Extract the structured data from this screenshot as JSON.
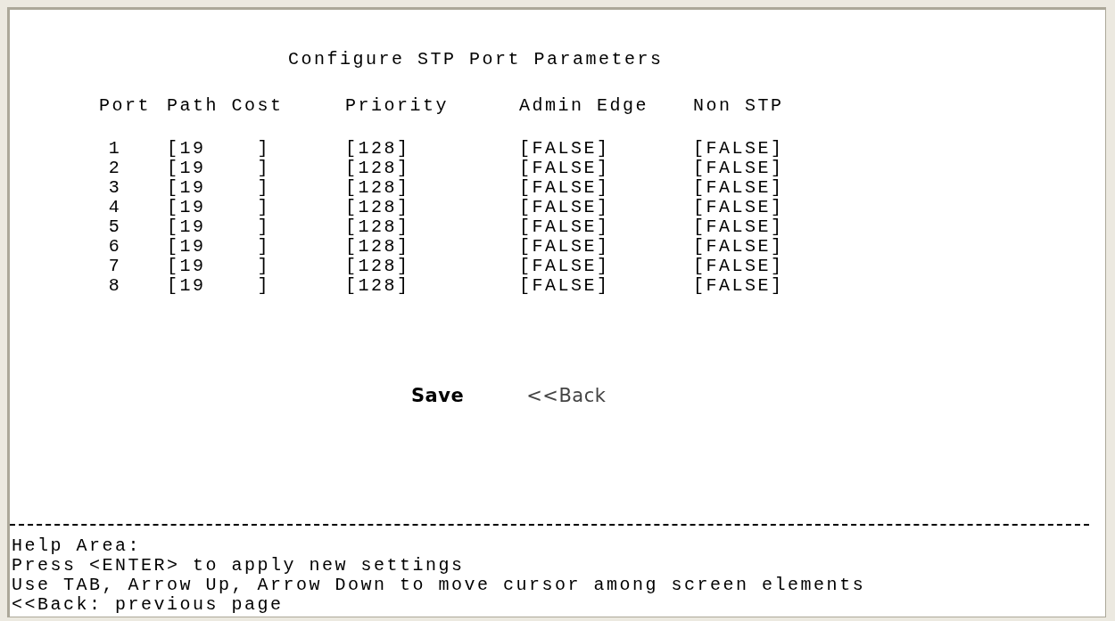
{
  "title": "Configure STP Port Parameters",
  "columns": [
    "Port",
    "Path Cost",
    "Priority",
    "Admin Edge",
    "Non STP"
  ],
  "rows": [
    {
      "port": "1",
      "path_cost": "[19    ]",
      "priority": "[128]",
      "admin_edge": "[FALSE]",
      "non_stp": "[FALSE]"
    },
    {
      "port": "2",
      "path_cost": "[19    ]",
      "priority": "[128]",
      "admin_edge": "[FALSE]",
      "non_stp": "[FALSE]"
    },
    {
      "port": "3",
      "path_cost": "[19    ]",
      "priority": "[128]",
      "admin_edge": "[FALSE]",
      "non_stp": "[FALSE]"
    },
    {
      "port": "4",
      "path_cost": "[19    ]",
      "priority": "[128]",
      "admin_edge": "[FALSE]",
      "non_stp": "[FALSE]"
    },
    {
      "port": "5",
      "path_cost": "[19    ]",
      "priority": "[128]",
      "admin_edge": "[FALSE]",
      "non_stp": "[FALSE]"
    },
    {
      "port": "6",
      "path_cost": "[19    ]",
      "priority": "[128]",
      "admin_edge": "[FALSE]",
      "non_stp": "[FALSE]"
    },
    {
      "port": "7",
      "path_cost": "[19    ]",
      "priority": "[128]",
      "admin_edge": "[FALSE]",
      "non_stp": "[FALSE]"
    },
    {
      "port": "8",
      "path_cost": "[19    ]",
      "priority": "[128]",
      "admin_edge": "[FALSE]",
      "non_stp": "[FALSE]"
    }
  ],
  "buttons": [
    {
      "label": "Save",
      "selected": true
    },
    {
      "label": "<<Back",
      "selected": false
    }
  ],
  "help": {
    "heading": "Help Area:",
    "lines": [
      "Press <ENTER> to apply new settings",
      "Use TAB, Arrow Up, Arrow Down to move cursor among screen elements",
      "<<Back: previous page"
    ]
  }
}
